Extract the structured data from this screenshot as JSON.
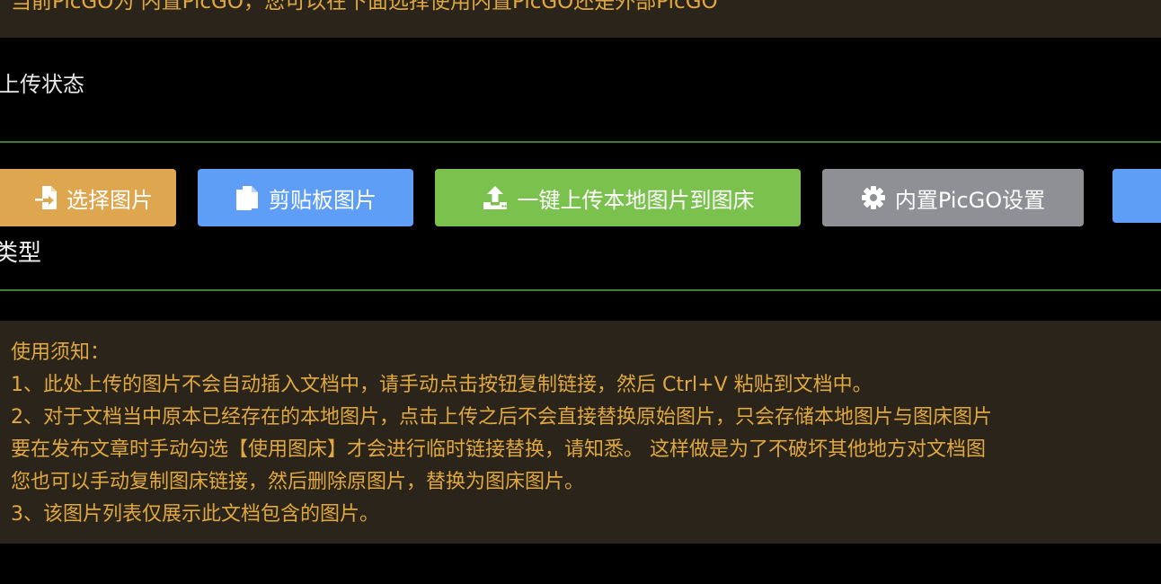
{
  "top_notice": "当前PicGO为 内置PicGO，您可以在下面选择使用内置PicGO还是外部PicGO",
  "upload_status_title": "上传状态",
  "buttons": {
    "select_image": "选择图片",
    "clipboard_image": "剪贴板图片",
    "upload_local": "一键上传本地图片到图床",
    "picgo_settings": "内置PicGO设置"
  },
  "type_label": "类型",
  "usage_notice": {
    "lines": [
      "使用须知：",
      "1、此处上传的图片不会自动插入文档中，请手动点击按钮复制链接，然后 Ctrl+V 粘贴到文档中。",
      "2、对于文档当中原本已经存在的本地图片，点击上传之后不会直接替换原始图片，只会存储本地图片与图床图片",
      "要在发布文章时手动勾选【使用图床】才会进行临时链接替换，请知悉。 这样做是为了不破坏其他地方对文档图",
      "您也可以手动复制图床链接，然后删除原图片，替换为图床图片。",
      "3、该图片列表仅展示此文档包含的图片。"
    ]
  },
  "icons": {
    "select": "file-import-icon",
    "clipboard": "copy-icon",
    "upload": "upload-icon",
    "settings": "gear-icon"
  },
  "colors": {
    "background": "#000000",
    "notice_bg": "#2b241b",
    "notice_text": "#e0a840",
    "divider": "#3f7d2c",
    "warning_button": "#dea64f",
    "primary_button": "#5f9ef6",
    "success_button": "#7bc14e",
    "info_button": "#8f9096"
  }
}
